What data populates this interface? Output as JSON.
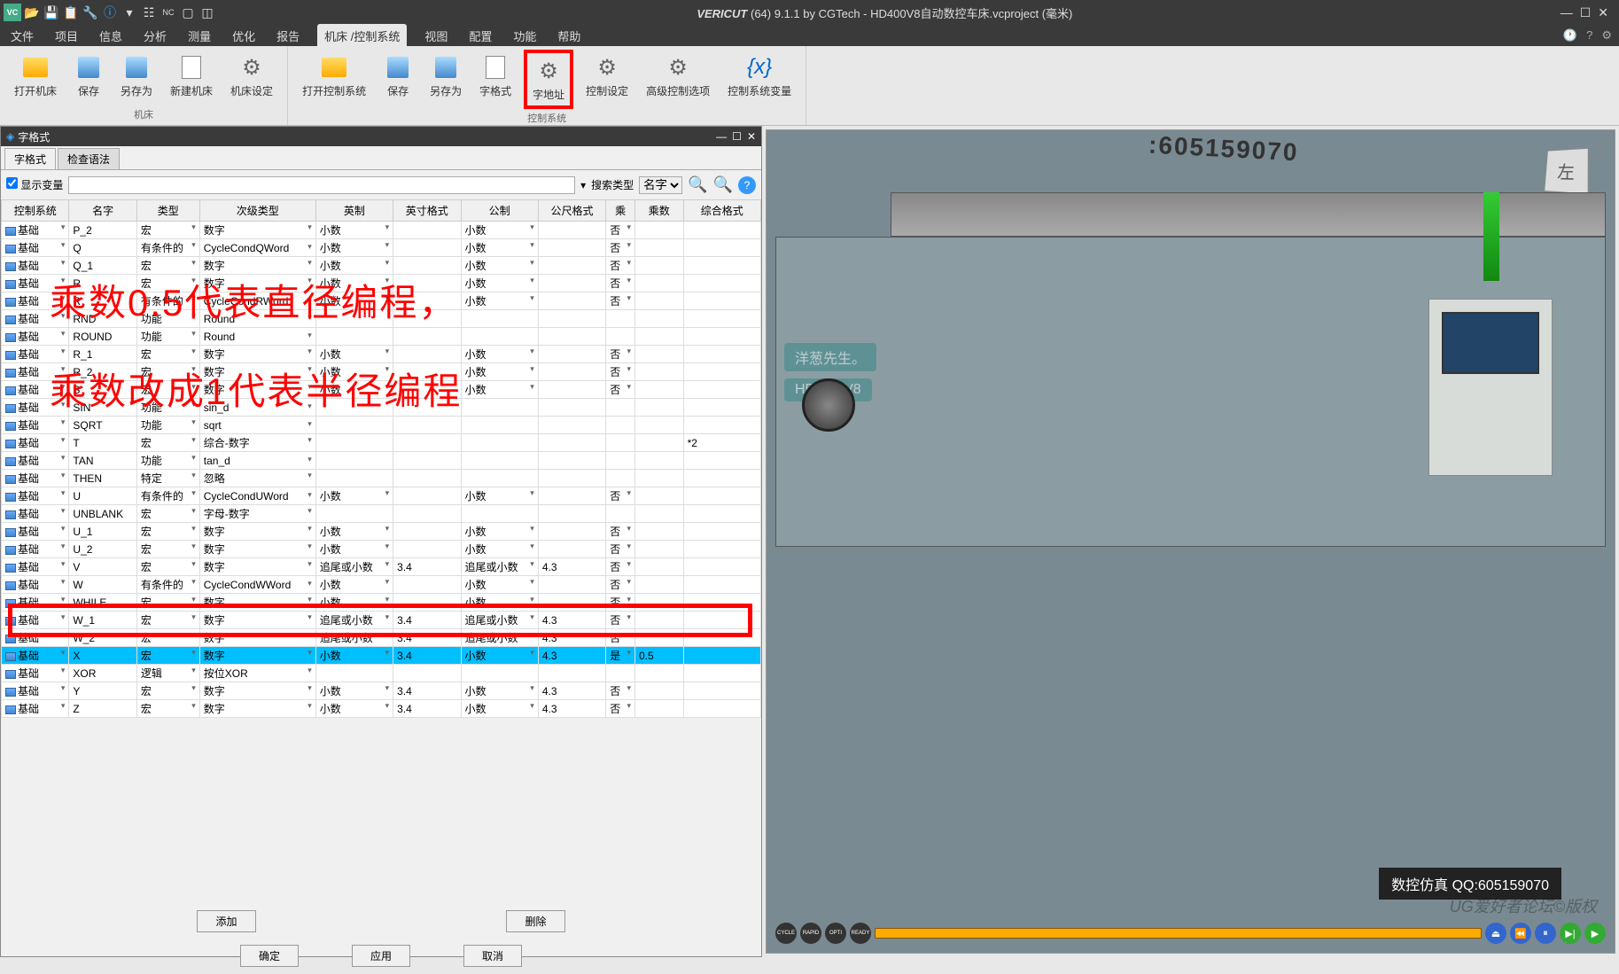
{
  "app": {
    "brand": "VERICUT",
    "title": "(64) 9.1.1 by CGTech - HD400V8自动数控车床.vcproject (毫米)"
  },
  "menu": {
    "items": [
      "文件",
      "项目",
      "信息",
      "分析",
      "测量",
      "优化",
      "报告",
      "机床 /控制系统",
      "视图",
      "配置",
      "功能",
      "帮助"
    ],
    "active_index": 7
  },
  "ribbon": {
    "groups": [
      {
        "label": "机床",
        "buttons": [
          {
            "label": "打开机床",
            "icon": "folder"
          },
          {
            "label": "保存",
            "icon": "disk"
          },
          {
            "label": "另存为",
            "icon": "disk"
          },
          {
            "label": "新建机床",
            "icon": "page"
          },
          {
            "label": "机床设定",
            "icon": "gear"
          }
        ]
      },
      {
        "label": "控制系统",
        "buttons": [
          {
            "label": "打开控制系统",
            "icon": "folder"
          },
          {
            "label": "保存",
            "icon": "disk"
          },
          {
            "label": "另存为",
            "icon": "disk"
          },
          {
            "label": "字格式",
            "icon": "page"
          },
          {
            "label": "字地址",
            "icon": "gear",
            "highlighted": true
          },
          {
            "label": "控制设定",
            "icon": "gear"
          },
          {
            "label": "高级控制选项",
            "icon": "gear"
          },
          {
            "label": "控制系统变量",
            "icon": "var"
          }
        ]
      }
    ]
  },
  "dialog": {
    "title": "字格式",
    "tabs": [
      "字格式",
      "检查语法"
    ],
    "show_vars_label": "显示变量",
    "search_type_label": "搜索类型",
    "search_field_label": "名字",
    "columns": [
      "控制系统",
      "名字",
      "类型",
      "次级类型",
      "英制",
      "英寸格式",
      "公制",
      "公尺格式",
      "乘",
      "乘数",
      "综合格式"
    ],
    "rows": [
      {
        "sys": "基础",
        "name": "P_2",
        "type": "宏",
        "sub": "数字",
        "en": "小数",
        "enfmt": "",
        "cn": "小数",
        "cnfmt": "",
        "mul": "否",
        "mulv": "",
        "comp": ""
      },
      {
        "sys": "基础",
        "name": "Q",
        "type": "有条件的",
        "sub": "CycleCondQWord",
        "en": "小数",
        "enfmt": "",
        "cn": "小数",
        "cnfmt": "",
        "mul": "否",
        "mulv": "",
        "comp": ""
      },
      {
        "sys": "基础",
        "name": "Q_1",
        "type": "宏",
        "sub": "数字",
        "en": "小数",
        "enfmt": "",
        "cn": "小数",
        "cnfmt": "",
        "mul": "否",
        "mulv": "",
        "comp": ""
      },
      {
        "sys": "基础",
        "name": "R",
        "type": "宏",
        "sub": "数字",
        "en": "小数",
        "enfmt": "",
        "cn": "小数",
        "cnfmt": "",
        "mul": "否",
        "mulv": "",
        "comp": ""
      },
      {
        "sys": "基础",
        "name": "R",
        "type": "有条件的",
        "sub": "CycleCondRWord",
        "en": "小数",
        "enfmt": "",
        "cn": "小数",
        "cnfmt": "",
        "mul": "否",
        "mulv": "",
        "comp": ""
      },
      {
        "sys": "基础",
        "name": "RND",
        "type": "功能",
        "sub": "Round",
        "en": "",
        "enfmt": "",
        "cn": "",
        "cnfmt": "",
        "mul": "",
        "mulv": "",
        "comp": ""
      },
      {
        "sys": "基础",
        "name": "ROUND",
        "type": "功能",
        "sub": "Round",
        "en": "",
        "enfmt": "",
        "cn": "",
        "cnfmt": "",
        "mul": "",
        "mulv": "",
        "comp": ""
      },
      {
        "sys": "基础",
        "name": "R_1",
        "type": "宏",
        "sub": "数字",
        "en": "小数",
        "enfmt": "",
        "cn": "小数",
        "cnfmt": "",
        "mul": "否",
        "mulv": "",
        "comp": ""
      },
      {
        "sys": "基础",
        "name": "R_2",
        "type": "宏",
        "sub": "数字",
        "en": "小数",
        "enfmt": "",
        "cn": "小数",
        "cnfmt": "",
        "mul": "否",
        "mulv": "",
        "comp": ""
      },
      {
        "sys": "基础",
        "name": "S",
        "type": "宏",
        "sub": "数字",
        "en": "小数",
        "enfmt": "",
        "cn": "小数",
        "cnfmt": "",
        "mul": "否",
        "mulv": "",
        "comp": ""
      },
      {
        "sys": "基础",
        "name": "SIN",
        "type": "功能",
        "sub": "sin_d",
        "en": "",
        "enfmt": "",
        "cn": "",
        "cnfmt": "",
        "mul": "",
        "mulv": "",
        "comp": ""
      },
      {
        "sys": "基础",
        "name": "SQRT",
        "type": "功能",
        "sub": "sqrt",
        "en": "",
        "enfmt": "",
        "cn": "",
        "cnfmt": "",
        "mul": "",
        "mulv": "",
        "comp": ""
      },
      {
        "sys": "基础",
        "name": "T",
        "type": "宏",
        "sub": "综合-数字",
        "en": "",
        "enfmt": "",
        "cn": "",
        "cnfmt": "",
        "mul": "",
        "mulv": "",
        "comp": "*2"
      },
      {
        "sys": "基础",
        "name": "TAN",
        "type": "功能",
        "sub": "tan_d",
        "en": "",
        "enfmt": "",
        "cn": "",
        "cnfmt": "",
        "mul": "",
        "mulv": "",
        "comp": ""
      },
      {
        "sys": "基础",
        "name": "THEN",
        "type": "特定",
        "sub": "忽略",
        "en": "",
        "enfmt": "",
        "cn": "",
        "cnfmt": "",
        "mul": "",
        "mulv": "",
        "comp": ""
      },
      {
        "sys": "基础",
        "name": "U",
        "type": "有条件的",
        "sub": "CycleCondUWord",
        "en": "小数",
        "enfmt": "",
        "cn": "小数",
        "cnfmt": "",
        "mul": "否",
        "mulv": "",
        "comp": ""
      },
      {
        "sys": "基础",
        "name": "UNBLANK",
        "type": "宏",
        "sub": "字母-数字",
        "en": "",
        "enfmt": "",
        "cn": "",
        "cnfmt": "",
        "mul": "",
        "mulv": "",
        "comp": ""
      },
      {
        "sys": "基础",
        "name": "U_1",
        "type": "宏",
        "sub": "数字",
        "en": "小数",
        "enfmt": "",
        "cn": "小数",
        "cnfmt": "",
        "mul": "否",
        "mulv": "",
        "comp": ""
      },
      {
        "sys": "基础",
        "name": "U_2",
        "type": "宏",
        "sub": "数字",
        "en": "小数",
        "enfmt": "",
        "cn": "小数",
        "cnfmt": "",
        "mul": "否",
        "mulv": "",
        "comp": ""
      },
      {
        "sys": "基础",
        "name": "V",
        "type": "宏",
        "sub": "数字",
        "en": "追尾或小数",
        "enfmt": "3.4",
        "cn": "追尾或小数",
        "cnfmt": "4.3",
        "mul": "否",
        "mulv": "",
        "comp": ""
      },
      {
        "sys": "基础",
        "name": "W",
        "type": "有条件的",
        "sub": "CycleCondWWord",
        "en": "小数",
        "enfmt": "",
        "cn": "小数",
        "cnfmt": "",
        "mul": "否",
        "mulv": "",
        "comp": ""
      },
      {
        "sys": "基础",
        "name": "WHILE",
        "type": "宏",
        "sub": "数字",
        "en": "小数",
        "enfmt": "",
        "cn": "小数",
        "cnfmt": "",
        "mul": "否",
        "mulv": "",
        "comp": ""
      },
      {
        "sys": "基础",
        "name": "W_1",
        "type": "宏",
        "sub": "数字",
        "en": "追尾或小数",
        "enfmt": "3.4",
        "cn": "追尾或小数",
        "cnfmt": "4.3",
        "mul": "否",
        "mulv": "",
        "comp": ""
      },
      {
        "sys": "基础",
        "name": "W_2",
        "type": "宏",
        "sub": "数字",
        "en": "追尾或小数",
        "enfmt": "3.4",
        "cn": "追尾或小数",
        "cnfmt": "4.3",
        "mul": "否",
        "mulv": "",
        "comp": ""
      },
      {
        "sys": "基础",
        "name": "X",
        "type": "宏",
        "sub": "数字",
        "en": "小数",
        "enfmt": "3.4",
        "cn": "小数",
        "cnfmt": "4.3",
        "mul": "是",
        "mulv": "0.5",
        "comp": "",
        "highlighted": true
      },
      {
        "sys": "基础",
        "name": "XOR",
        "type": "逻辑",
        "sub": "按位XOR",
        "en": "",
        "enfmt": "",
        "cn": "",
        "cnfmt": "",
        "mul": "",
        "mulv": "",
        "comp": ""
      },
      {
        "sys": "基础",
        "name": "Y",
        "type": "宏",
        "sub": "数字",
        "en": "小数",
        "enfmt": "3.4",
        "cn": "小数",
        "cnfmt": "4.3",
        "mul": "否",
        "mulv": "",
        "comp": ""
      },
      {
        "sys": "基础",
        "name": "Z",
        "type": "宏",
        "sub": "数字",
        "en": "小数",
        "enfmt": "3.4",
        "cn": "小数",
        "cnfmt": "4.3",
        "mul": "否",
        "mulv": "",
        "comp": ""
      }
    ],
    "add_label": "添加",
    "delete_label": "删除",
    "ok_label": "确定",
    "apply_label": "应用",
    "cancel_label": "取消"
  },
  "annotations": {
    "line1": "乘数0.5代表直径编程，",
    "line2": "乘数改成1代表半径编程"
  },
  "viewport": {
    "serial": ":605159070",
    "cube_face": "左",
    "brand_label": "洋葱先生。",
    "model_label": "HD400-V8",
    "footer_label": "数控仿真 QQ:605159070",
    "playback": {
      "buttons": [
        "CYCLE",
        "RAPID",
        "OPTI",
        "READY"
      ]
    },
    "watermark": "UG爱好者论坛©版权"
  }
}
